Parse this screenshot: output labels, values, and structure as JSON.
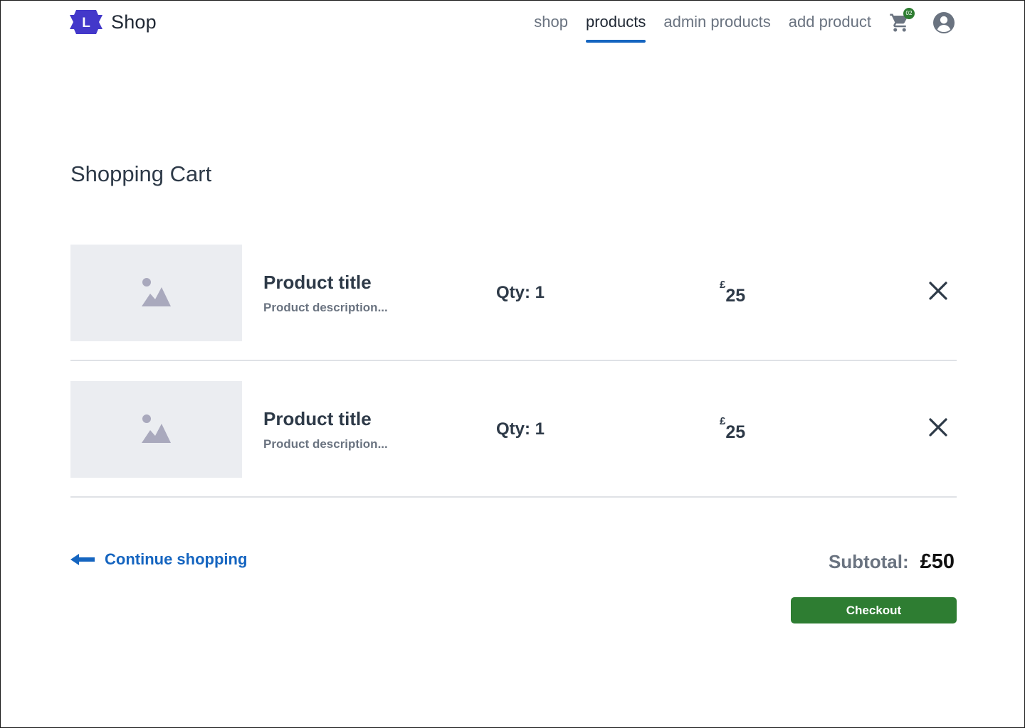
{
  "header": {
    "brand": {
      "logo_letter": "L",
      "name": "Shop"
    },
    "nav": [
      {
        "label": "shop",
        "active": false
      },
      {
        "label": "products",
        "active": true
      },
      {
        "label": "admin products",
        "active": false
      },
      {
        "label": "add product",
        "active": false
      }
    ],
    "cart": {
      "icon": "cart-icon",
      "count": "02"
    },
    "account": {
      "icon": "user-icon"
    }
  },
  "page": {
    "title": "Shopping Cart"
  },
  "cart_items": [
    {
      "title": "Product title",
      "description": "Product description...",
      "qty": "Qty: 1",
      "currency": "£",
      "price": "25"
    },
    {
      "title": "Product title",
      "description": "Product description...",
      "qty": "Qty: 1",
      "currency": "£",
      "price": "25"
    }
  ],
  "footer": {
    "continue_label": "Continue shopping",
    "subtotal_label": "Subtotal:",
    "subtotal_value": "£50",
    "checkout_label": "Checkout"
  },
  "colors": {
    "brand": "#4338ca",
    "link": "#1565c0",
    "success": "#2e7d32",
    "placeholder": "#ebedf1"
  }
}
